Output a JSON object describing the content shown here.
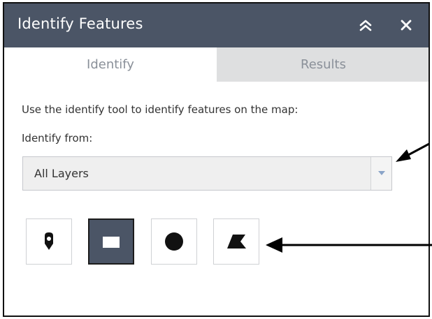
{
  "panel": {
    "title": "Identify Features",
    "collapse_icon": "double-chevron-up-icon",
    "close_icon": "close-icon"
  },
  "tabs": [
    {
      "label": "Identify",
      "active": true
    },
    {
      "label": "Results",
      "active": false
    }
  ],
  "identify": {
    "instruction": "Use the identify tool to identify features on the map:",
    "from_label": "Identify from:",
    "layer_select": {
      "selected": "All Layers",
      "arrow_icon": "dropdown-arrow-icon"
    },
    "tools": [
      {
        "name": "point",
        "icon": "point-marker-icon",
        "selected": false
      },
      {
        "name": "rectangle",
        "icon": "rectangle-icon",
        "selected": true
      },
      {
        "name": "circle",
        "icon": "circle-icon",
        "selected": false
      },
      {
        "name": "polygon",
        "icon": "polygon-icon",
        "selected": false
      }
    ]
  },
  "annotations": [
    {
      "points_to": "layer-select-arrow",
      "icon": "arrow-icon"
    },
    {
      "points_to": "drawing-tools",
      "icon": "arrow-icon"
    }
  ],
  "colors": {
    "header_bg": "#4b5566",
    "inactive_tab_bg": "#dedfe0",
    "tab_text": "#8a9099",
    "selected_tool_bg": "#4b5566",
    "text": "#333333"
  }
}
